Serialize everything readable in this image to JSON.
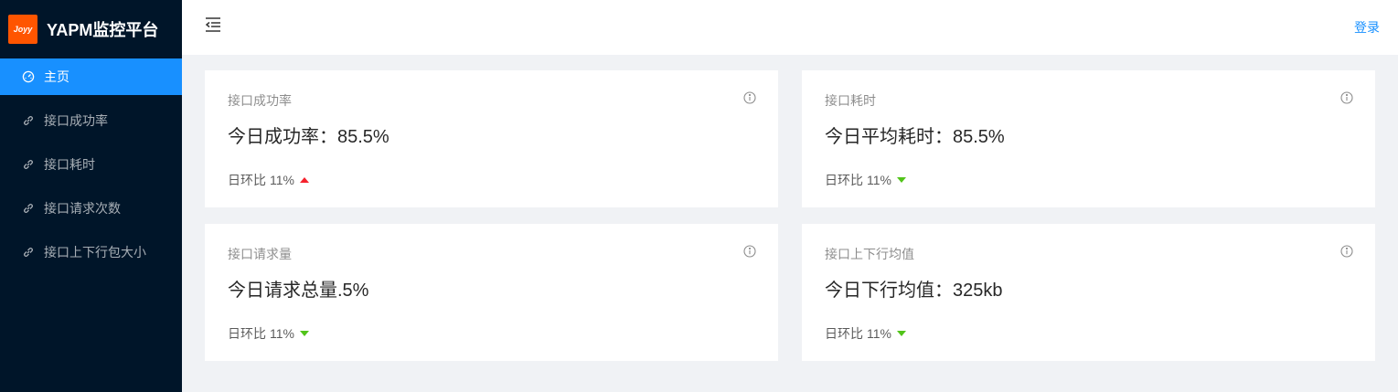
{
  "app": {
    "logo_text": "Joyy",
    "title": "YAPM监控平台"
  },
  "menu": [
    {
      "label": "主页",
      "icon": "dashboard-icon",
      "active": true
    },
    {
      "label": "接口成功率",
      "icon": "link-icon",
      "active": false
    },
    {
      "label": "接口耗时",
      "icon": "link-icon",
      "active": false
    },
    {
      "label": "接口请求次数",
      "icon": "link-icon",
      "active": false
    },
    {
      "label": "接口上下行包大小",
      "icon": "link-icon",
      "active": false
    }
  ],
  "header": {
    "login_label": "登录"
  },
  "cards": [
    {
      "title": "接口成功率",
      "value": "今日成功率：85.5%",
      "ratio_label": "日环比",
      "ratio_value": "11%",
      "trend": "up"
    },
    {
      "title": "接口耗时",
      "value": "今日平均耗时：85.5%",
      "ratio_label": "日环比",
      "ratio_value": "11%",
      "trend": "down"
    },
    {
      "title": "接口请求量",
      "value": "今日请求总量.5%",
      "ratio_label": "日环比",
      "ratio_value": "11%",
      "trend": "down"
    },
    {
      "title": "接口上下行均值",
      "value": "今日下行均值：325kb",
      "ratio_label": "日环比",
      "ratio_value": "11%",
      "trend": "down"
    }
  ],
  "colors": {
    "sider_bg": "#001529",
    "active": "#1890ff",
    "trend_up": "#f5222d",
    "trend_down": "#52c41a",
    "logo_bg": "#ff5500"
  }
}
